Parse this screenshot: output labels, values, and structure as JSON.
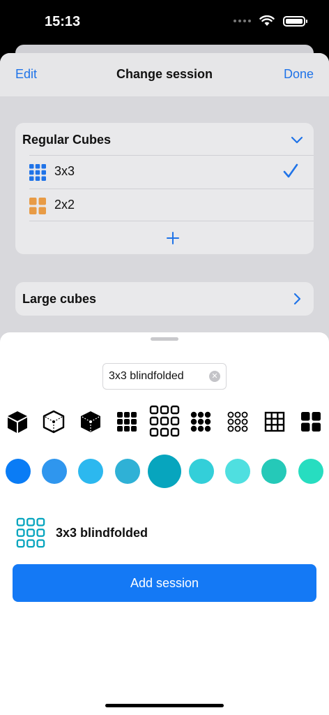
{
  "status_bar": {
    "time": "15:13"
  },
  "nav": {
    "edit_label": "Edit",
    "title": "Change session",
    "done_label": "Done"
  },
  "groups": [
    {
      "title": "Regular Cubes",
      "expanded": true,
      "items": [
        {
          "label": "3x3",
          "icon": "grid-3x3-icon",
          "color": "#1f73e8",
          "selected": true
        },
        {
          "label": "2x2",
          "icon": "grid-2x2-icon",
          "color": "#e89b45",
          "selected": false
        }
      ]
    },
    {
      "title": "Large cubes",
      "expanded": false
    }
  ],
  "new_session": {
    "name_value": "3x3 blindfolded",
    "icons": [
      "cube-solid-icon",
      "cube-wireframe-icon",
      "cube-scrambled-icon",
      "grid-3x3-rounded-icon",
      "grid-3x3-outline-icon",
      "dots-3x3-icon",
      "rings-3x3-icon",
      "grid-lines-icon",
      "grid-2x2-icon"
    ],
    "selected_icon": 4,
    "colors": [
      "#0a7cf5",
      "#2f96ee",
      "#2cb8ef",
      "#2fb1d6",
      "#07a5be",
      "#33cfd9",
      "#4fdfe0",
      "#25c9b8",
      "#27ddc0"
    ],
    "selected_color": 4,
    "preview_label": "3x3 blindfolded",
    "add_button_label": "Add session"
  }
}
